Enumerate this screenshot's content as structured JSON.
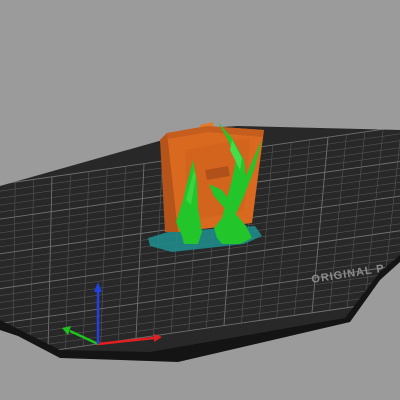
{
  "viewport": {
    "bed_label": "ORIGINAL P",
    "colors": {
      "background": "#9b9b9b",
      "bed_surface": "#282828",
      "bed_edge": "#141414",
      "grid": "#5a5a5a",
      "model_orange": "#d8691e",
      "support_green": "#22c52a",
      "axis_x": "#e02020",
      "axis_y": "#20c020",
      "axis_z": "#2040e0"
    },
    "axes": [
      "x-axis",
      "y-axis",
      "z-axis"
    ]
  }
}
